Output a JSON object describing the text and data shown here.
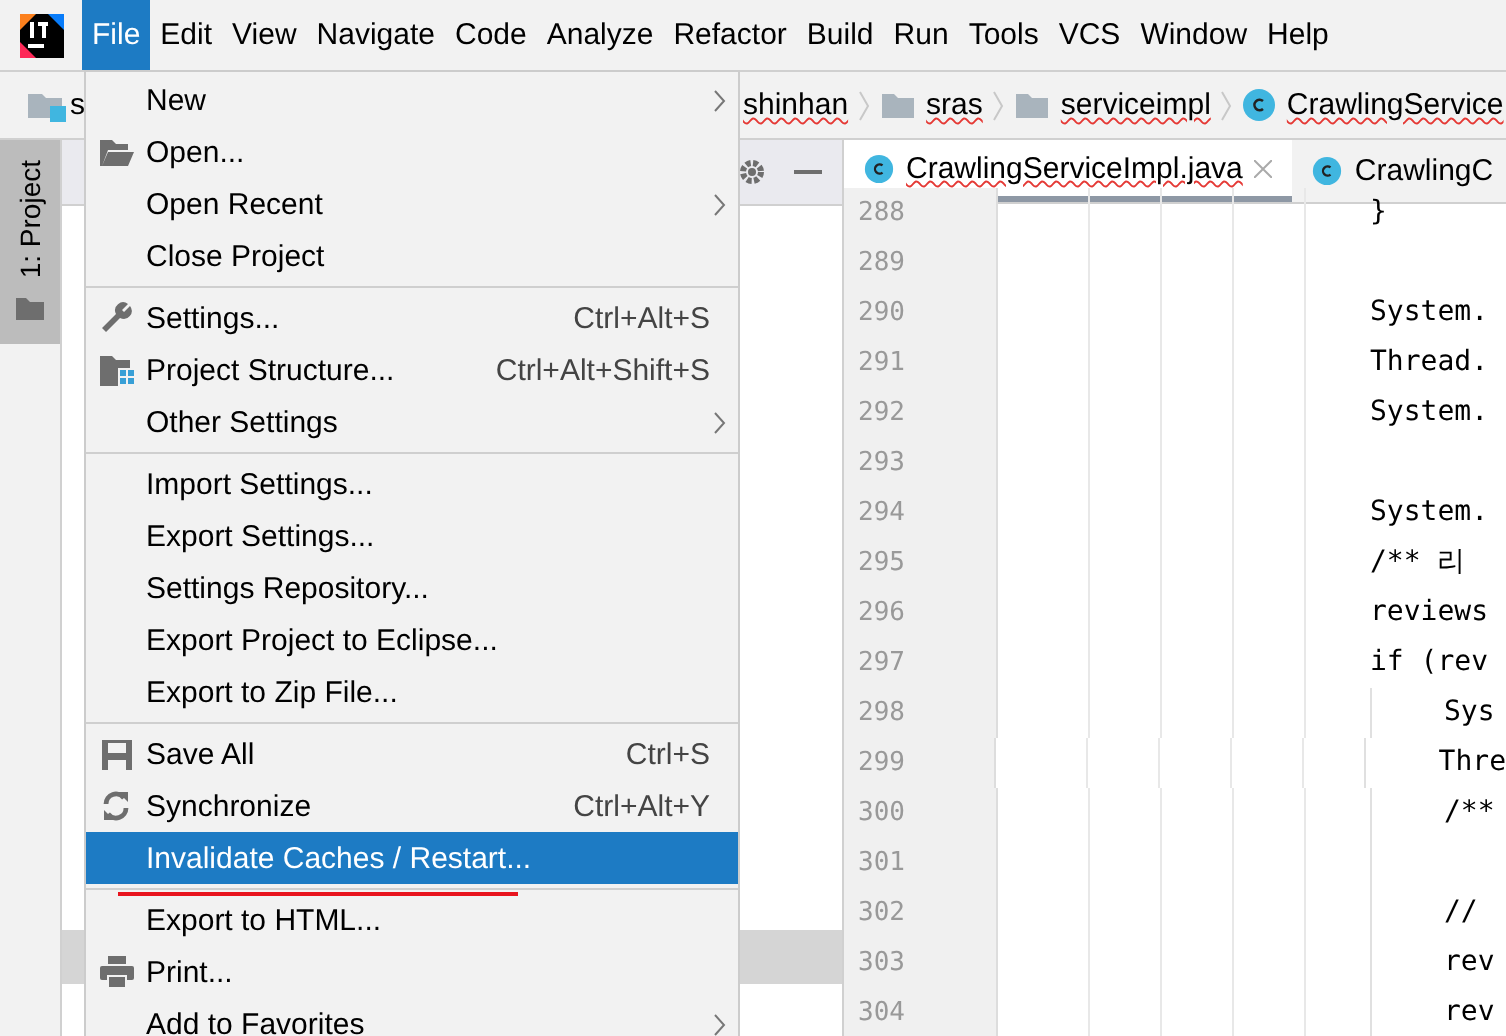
{
  "menubar": [
    {
      "label": "File",
      "selected": true
    },
    {
      "label": "Edit",
      "selected": false
    },
    {
      "label": "View",
      "selected": false
    },
    {
      "label": "Navigate",
      "selected": false
    },
    {
      "label": "Code",
      "selected": false
    },
    {
      "label": "Analyze",
      "selected": false
    },
    {
      "label": "Refactor",
      "selected": false
    },
    {
      "label": "Build",
      "selected": false
    },
    {
      "label": "Run",
      "selected": false
    },
    {
      "label": "Tools",
      "selected": false
    },
    {
      "label": "VCS",
      "selected": false
    },
    {
      "label": "Window",
      "selected": false
    },
    {
      "label": "Help",
      "selected": false
    }
  ],
  "breadcrumbs": [
    {
      "label": "s",
      "kind": "module"
    },
    {
      "label": "shinhan",
      "kind": "text"
    },
    {
      "label": "sras",
      "kind": "folder"
    },
    {
      "label": "serviceimpl",
      "kind": "folder"
    },
    {
      "label": "CrawlingService",
      "kind": "class"
    }
  ],
  "tool_strip": {
    "label": "1: Project"
  },
  "editor_tabs": [
    {
      "label": "CrawlingServiceImpl.java",
      "selected": true
    },
    {
      "label": "CrawlingC",
      "selected": false
    }
  ],
  "code_lines": [
    {
      "number": "288",
      "text": "}",
      "in_block": false
    },
    {
      "number": "289",
      "in_block": false
    },
    {
      "number": "290",
      "text": "System.",
      "in_block": false
    },
    {
      "number": "291",
      "text": "Thread.",
      "in_block": false
    },
    {
      "number": "292",
      "text": "System.",
      "in_block": false
    },
    {
      "number": "293",
      "in_block": false
    },
    {
      "number": "294",
      "text": "System.",
      "in_block": false
    },
    {
      "number": "295",
      "text": "/** 리",
      "in_block": false
    },
    {
      "number": "296",
      "text": "reviews",
      "in_block": false
    },
    {
      "number": "297",
      "text": "if (rev",
      "in_block": false
    },
    {
      "number": "298",
      "text": "Sys",
      "in_block": true
    },
    {
      "number": "299",
      "text": "Thre",
      "in_block": true
    },
    {
      "number": "300",
      "text": "/**",
      "in_block": true
    },
    {
      "number": "301",
      "in_block": true
    },
    {
      "number": "302",
      "text": "//",
      "in_block": true
    },
    {
      "number": "303",
      "text": "rev",
      "in_block": true
    },
    {
      "number": "304",
      "text": "rev",
      "in_block": true
    }
  ],
  "file_menu": [
    {
      "kind": "item",
      "label": "New",
      "submenu": true,
      "selected": false,
      "annotated": false
    },
    {
      "kind": "item",
      "label": "Open...",
      "submenu": false,
      "selected": false,
      "annotated": false
    },
    {
      "kind": "item",
      "label": "Open Recent",
      "submenu": true,
      "selected": false,
      "annotated": false
    },
    {
      "kind": "item",
      "label": "Close Project",
      "submenu": false,
      "selected": false,
      "annotated": false
    },
    {
      "kind": "separator"
    },
    {
      "kind": "item",
      "label": "Settings...",
      "shortcut": "Ctrl+Alt+S",
      "submenu": false,
      "selected": false,
      "annotated": false
    },
    {
      "kind": "item",
      "label": "Project Structure...",
      "shortcut": "Ctrl+Alt+Shift+S",
      "submenu": false,
      "selected": false,
      "annotated": false
    },
    {
      "kind": "item",
      "label": "Other Settings",
      "submenu": true,
      "selected": false,
      "annotated": false
    },
    {
      "kind": "separator"
    },
    {
      "kind": "item",
      "label": "Import Settings...",
      "submenu": false,
      "selected": false,
      "annotated": false
    },
    {
      "kind": "item",
      "label": "Export Settings...",
      "submenu": false,
      "selected": false,
      "annotated": false
    },
    {
      "kind": "item",
      "label": "Settings Repository...",
      "submenu": false,
      "selected": false,
      "annotated": false
    },
    {
      "kind": "item",
      "label": "Export Project to Eclipse...",
      "submenu": false,
      "selected": false,
      "annotated": false
    },
    {
      "kind": "item",
      "label": "Export to Zip File...",
      "submenu": false,
      "selected": false,
      "annotated": false
    },
    {
      "kind": "separator"
    },
    {
      "kind": "item",
      "label": "Save All",
      "shortcut": "Ctrl+S",
      "submenu": false,
      "selected": false,
      "annotated": false
    },
    {
      "kind": "item",
      "label": "Synchronize",
      "shortcut": "Ctrl+Alt+Y",
      "submenu": false,
      "selected": false,
      "annotated": false
    },
    {
      "kind": "item",
      "label": "Invalidate Caches / Restart...",
      "submenu": false,
      "selected": true,
      "annotated": true
    },
    {
      "kind": "separator"
    },
    {
      "kind": "item",
      "label": "Export to HTML...",
      "submenu": false,
      "selected": false
    },
    {
      "kind": "item",
      "label": "Print...",
      "submenu": false,
      "selected": false
    },
    {
      "kind": "item",
      "label": "Add to Favorites",
      "submenu": true,
      "selected": false
    }
  ]
}
